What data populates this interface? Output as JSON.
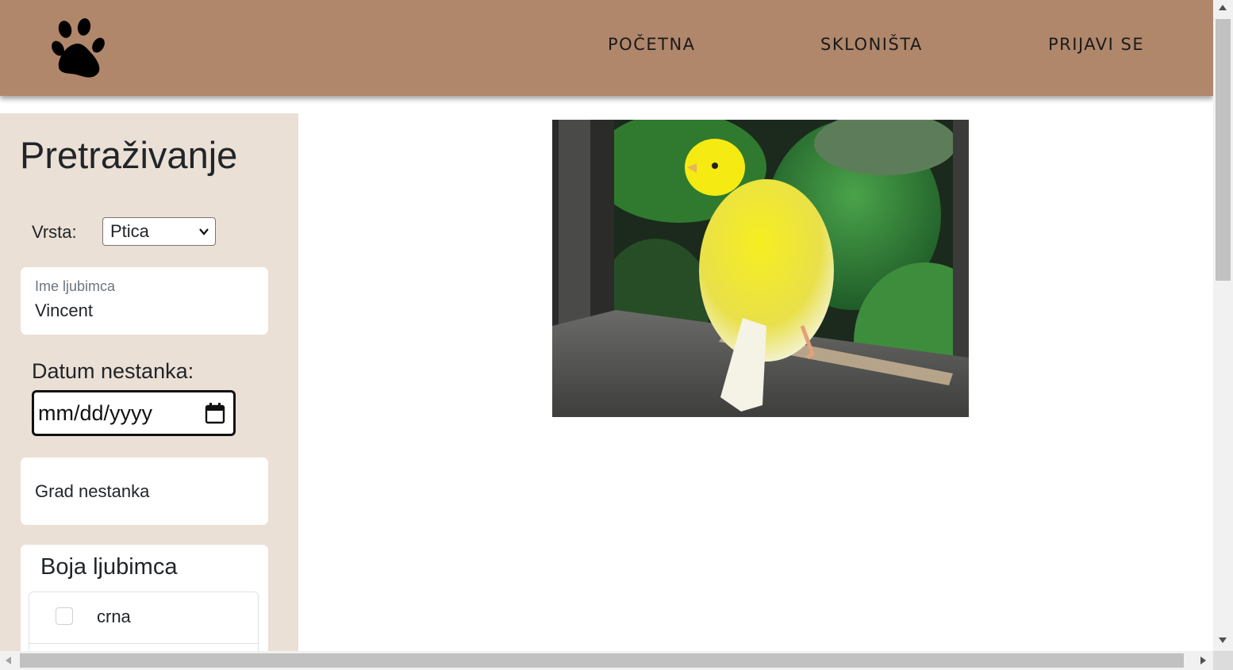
{
  "navbar": {
    "logo_icon": "paw-print-icon",
    "links": [
      "POČETNA",
      "SKLONIŠTA",
      "PRIJAVI SE"
    ],
    "background": "#b0876b"
  },
  "sidebar": {
    "title": "Pretraživanje",
    "background": "#ebe0d6",
    "species": {
      "label": "Vrsta:",
      "selected": "Ptica"
    },
    "pet_name": {
      "label": "Ime ljubimca",
      "value": "Vincent"
    },
    "missing_date": {
      "label": "Datum nestanka:",
      "placeholder": "mm/dd/yyyy",
      "icon": "calendar-icon"
    },
    "missing_city": {
      "placeholder": "Grad nestanka"
    },
    "color": {
      "title": "Boja ljubimca",
      "options": [
        {
          "label": "crna",
          "checked": false
        }
      ]
    }
  },
  "main": {
    "image_subject": "yellow canary bird perched on window ledge"
  }
}
